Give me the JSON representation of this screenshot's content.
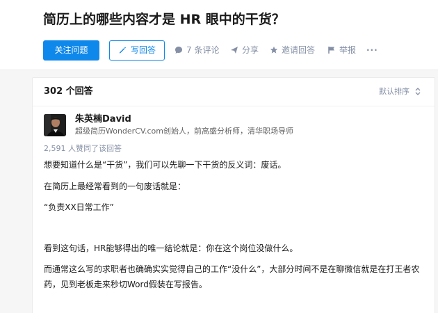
{
  "question": {
    "title": "简历上的哪些内容才是 HR 眼中的干货？",
    "follow_label": "关注问题",
    "write_label": "写回答",
    "actions": {
      "comments": "7 条评论",
      "share": "分享",
      "invite": "邀请回答",
      "report": "举报",
      "more": "···"
    }
  },
  "answers": {
    "count_label": "302 个回答",
    "sort_label": "默认排序"
  },
  "answer": {
    "author_name": "朱英楠David",
    "author_bio": "超级简历WonderCV.com创始人，前高盛分析师，清华职场导师",
    "votes": "2,591 人赞同了该回答",
    "paragraphs": [
      "想要知道什么是“干货”，我们可以先聊一下干货的反义词：废话。",
      "在简历上最经常看到的一句废话就是：",
      "“负责XX日常工作”",
      "看到这句话，HR能够得出的唯一结论就是：你在这个岗位没做什么。",
      "而通常这么写的求职者也确确实实觉得自己的工作“没什么”，大部分时间不是在聊微信就是在打王者农药，见到老板走来秒切Word假装在写报告。"
    ]
  },
  "colors": {
    "accent": "#0f88eb",
    "muted": "#8590a6",
    "background": "#f6f6f6"
  },
  "icons": [
    "edit-icon",
    "comment-icon",
    "share-icon",
    "star-icon",
    "report-icon",
    "sort-icon"
  ]
}
